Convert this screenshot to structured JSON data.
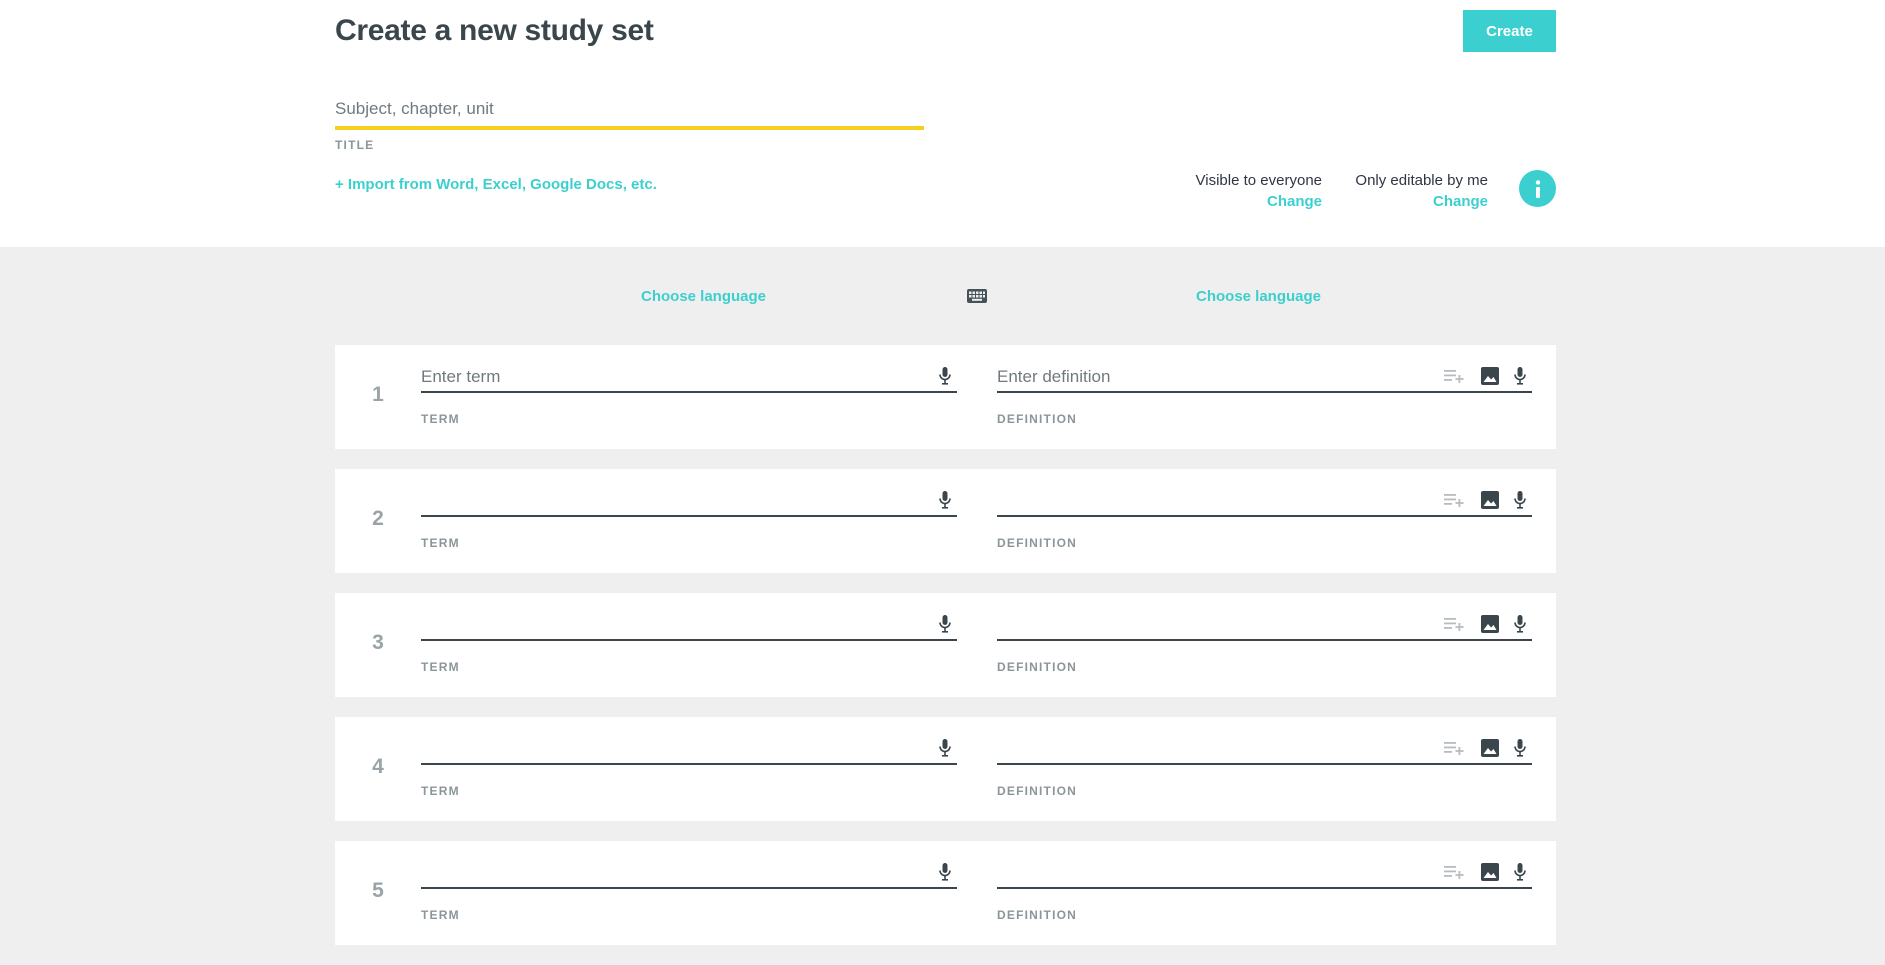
{
  "header": {
    "title": "Create a new study set",
    "create_label": "Create",
    "title_placeholder": "Subject, chapter, unit",
    "title_field_label": "TITLE",
    "import_label": "+ Import from Word, Excel, Google Docs, etc.",
    "visibility_text": "Visible to everyone",
    "visibility_change": "Change",
    "editable_text": "Only editable by me",
    "editable_change": "Change"
  },
  "languages": {
    "term_label": "Choose language",
    "definition_label": "Choose language"
  },
  "cards": [
    {
      "number": "1",
      "term_placeholder": "Enter term",
      "definition_placeholder": "Enter definition",
      "term_label": "TERM",
      "definition_label": "DEFINITION"
    },
    {
      "number": "2",
      "term_placeholder": "",
      "definition_placeholder": "",
      "term_label": "TERM",
      "definition_label": "DEFINITION"
    },
    {
      "number": "3",
      "term_placeholder": "",
      "definition_placeholder": "",
      "term_label": "TERM",
      "definition_label": "DEFINITION"
    },
    {
      "number": "4",
      "term_placeholder": "",
      "definition_placeholder": "",
      "term_label": "TERM",
      "definition_label": "DEFINITION"
    },
    {
      "number": "5",
      "term_placeholder": "",
      "definition_placeholder": "",
      "term_label": "TERM",
      "definition_label": "DEFINITION"
    }
  ],
  "colors": {
    "accent": "#3ccfcf",
    "title_underline": "#f5cf1f",
    "background": "#efefef",
    "text_dark": "#3a464b"
  },
  "icons": {
    "info": "info-icon",
    "keyboard": "keyboard-icon",
    "mic": "microphone-icon",
    "image": "image-icon",
    "add_list": "playlist-add-icon"
  }
}
